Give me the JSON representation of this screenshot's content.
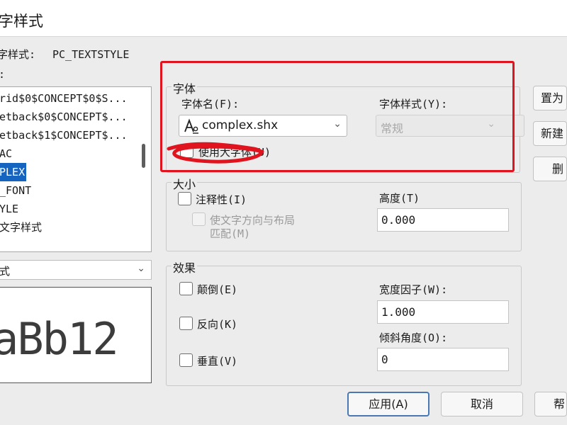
{
  "window": {
    "title": "字样式"
  },
  "current_style": {
    "label": "字样式:",
    "value": "PC_TEXTSTYLE"
  },
  "styles_label": ":",
  "style_list": {
    "items": [
      {
        "label": "rid$0$CONCEPT$0$S..."
      },
      {
        "label": "etback$0$CONCEPT$..."
      },
      {
        "label": "etback$1$CONCEPT$..."
      },
      {
        "label": "AC"
      },
      {
        "label": "PLEX"
      },
      {
        "label": "_FONT"
      },
      {
        "label": "YLE"
      },
      {
        "label": "文字样式"
      }
    ],
    "selected_index": 4
  },
  "filter": {
    "value": "式"
  },
  "preview": {
    "text": "aBb12"
  },
  "font_group": {
    "title": "字体",
    "font_name_label": "字体名(F):",
    "font_name_value": "complex.shx",
    "font_style_label": "字体样式(Y):",
    "font_style_value": "常规",
    "bigfont_label": "使用大字体(U)",
    "bigfont_checked": false
  },
  "size_group": {
    "title": "大小",
    "annotative_label": "注释性(I)",
    "annotative_checked": false,
    "match_label_line1": "使文字方向与布局",
    "match_label_line2": "匹配(M)",
    "height_label": "高度(T)",
    "height_value": "0.000"
  },
  "effects_group": {
    "title": "效果",
    "upside_down_label": "颠倒(E)",
    "backwards_label": "反向(K)",
    "vertical_label": "垂直(V)",
    "width_factor_label": "宽度因子(W):",
    "width_factor_value": "1.000",
    "oblique_label": "倾斜角度(O):",
    "oblique_value": "0"
  },
  "side_buttons": {
    "set_current": "置为",
    "new": "新建",
    "delete": "删"
  },
  "bottom_buttons": {
    "apply": "应用(A)",
    "cancel": "取消",
    "help": "帮"
  },
  "colors": {
    "selection": "#1565c0",
    "annotation_red": "#e0141e",
    "default_button_border": "#4a78b3"
  },
  "icons": {
    "font_type": "shx-font-icon"
  }
}
